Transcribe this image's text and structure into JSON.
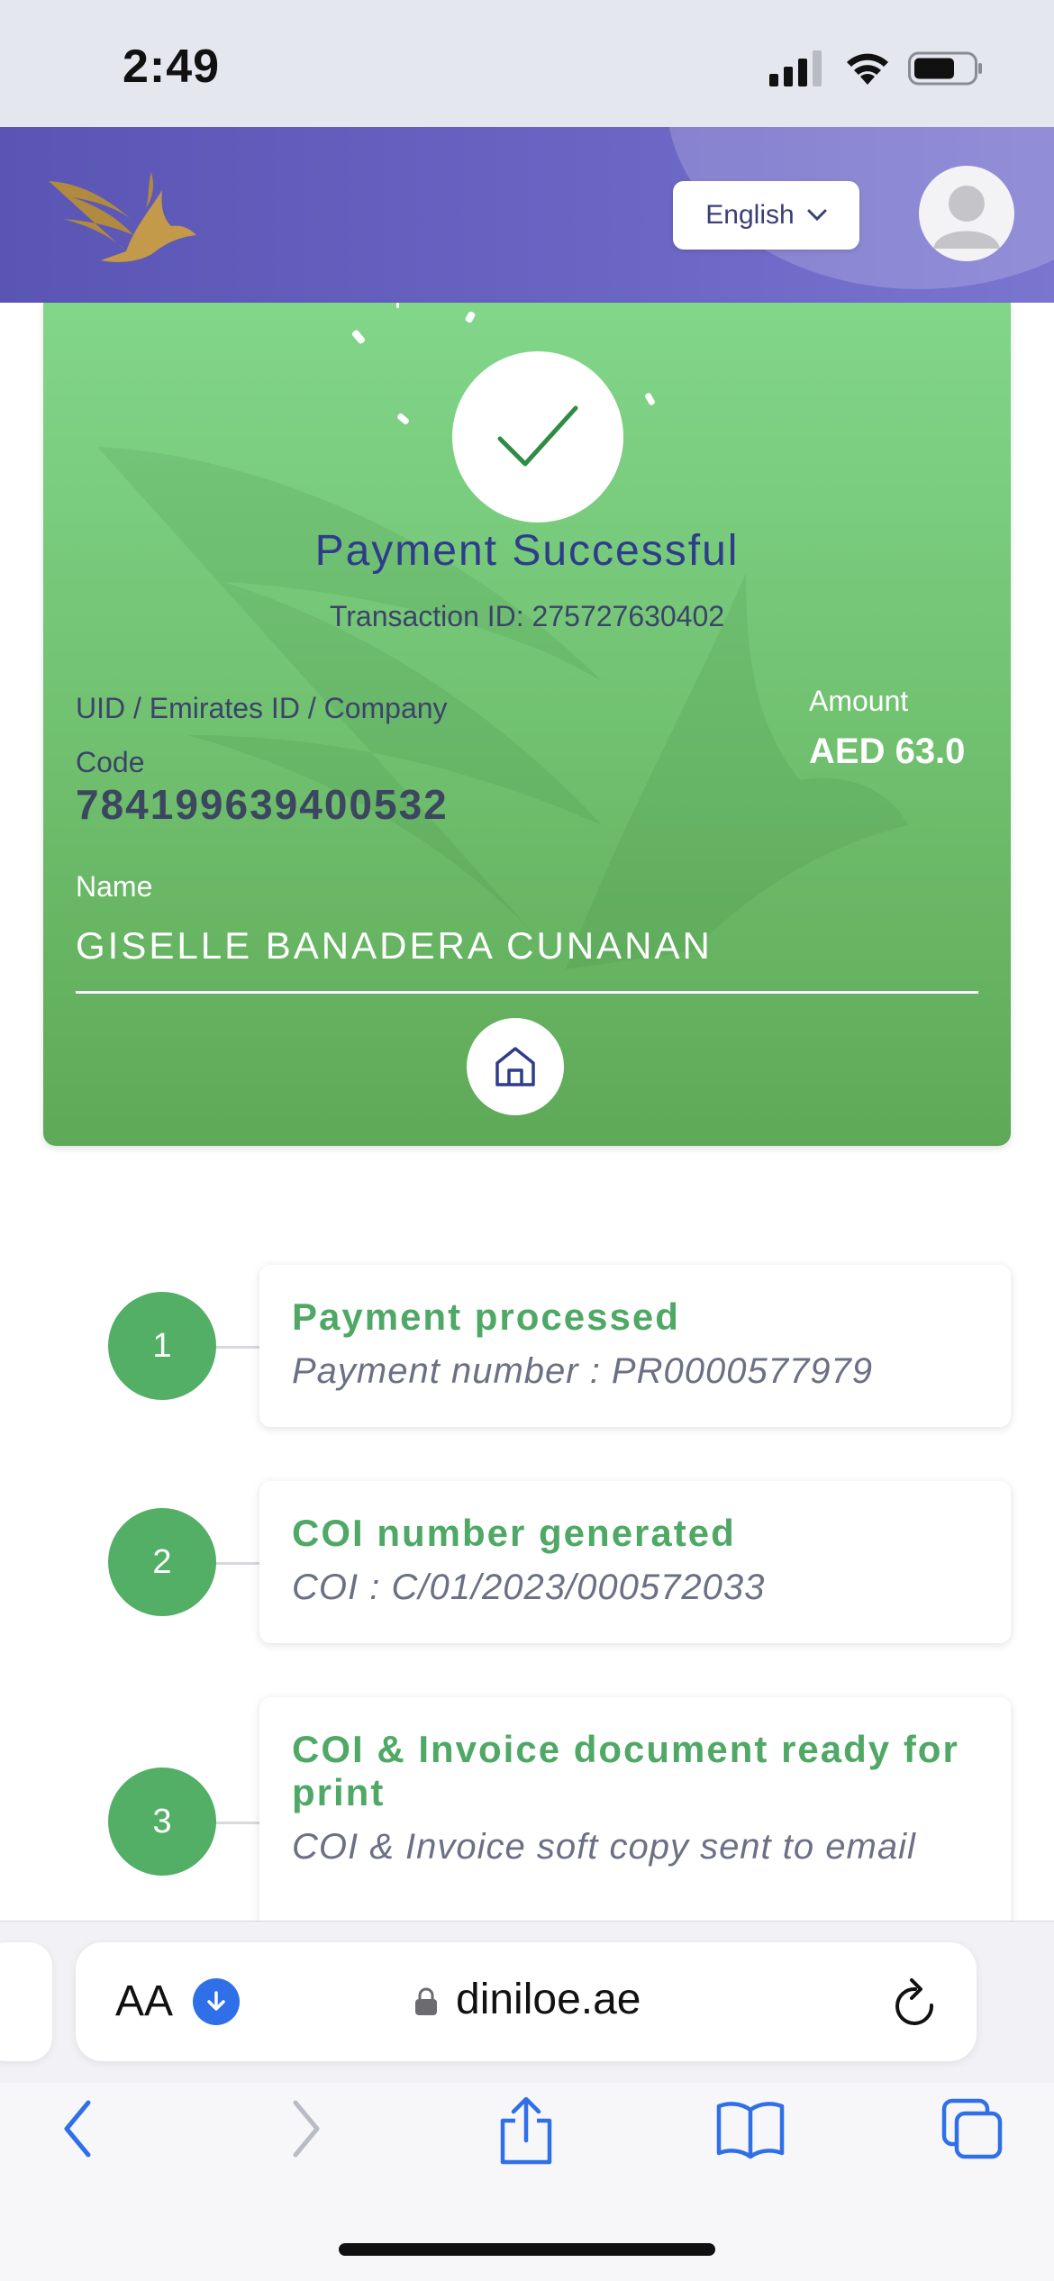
{
  "status_bar": {
    "time": "2:49"
  },
  "header": {
    "language": "English"
  },
  "success": {
    "title": "Payment Successful",
    "transaction_id": "Transaction ID: 275727630402",
    "uid_label": "UID / Emirates ID / Company Code",
    "uid_value": "784199639400532",
    "amount_label": "Amount",
    "amount_value": "AED 63.0",
    "name_label": "Name",
    "name_value": "GISELLE BANADERA CUNANAN"
  },
  "steps": [
    {
      "number": "1",
      "title": "Payment processed",
      "subtitle": "Payment number : PR0000577979"
    },
    {
      "number": "2",
      "title": "COI number generated",
      "subtitle": "COI : C/01/2023/000572033"
    },
    {
      "number": "3",
      "title": "COI & Invoice document ready for print",
      "subtitle": "COI & Invoice soft copy sent to email"
    }
  ],
  "browser": {
    "aa": "AA",
    "url": "diniloe.ae"
  },
  "colors": {
    "header": "#5a55b4",
    "card_green": "#6fbf6e",
    "step_green": "#52af65",
    "title_navy": "#2f3c8a"
  }
}
